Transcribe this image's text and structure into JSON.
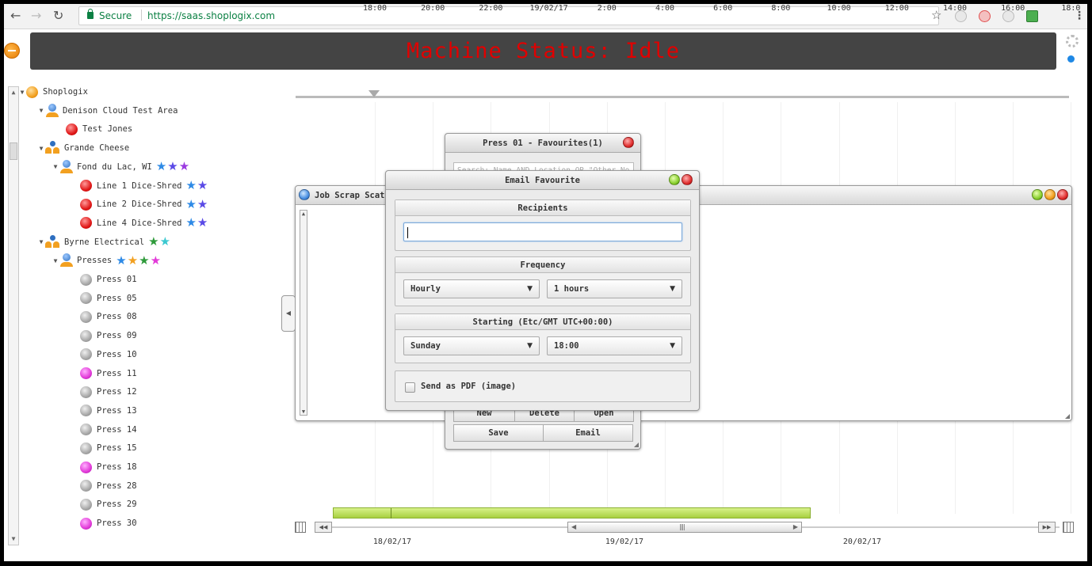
{
  "browser": {
    "secure_label": "Secure",
    "url": "https://saas.shoplogix.com"
  },
  "header": {
    "status_text": "Machine Status: Idle"
  },
  "tree": [
    {
      "label": "Shoplogix",
      "icon": "ball-orange",
      "stars": []
    },
    {
      "label": "Denison Cloud Test Area",
      "icon": "person-icon",
      "stars": []
    },
    {
      "label": "Test Jones",
      "icon": "ball-red",
      "stars": []
    },
    {
      "label": "Grande Cheese",
      "icon": "people-icon",
      "stars": []
    },
    {
      "label": "Fond du Lac, WI",
      "icon": "person-icon",
      "stars": [
        "#2e8ae6",
        "#5a4ae6",
        "#9a3ae0"
      ]
    },
    {
      "label": "Line 1 Dice-Shred",
      "icon": "ball-red",
      "stars": [
        "#2e8ae6",
        "#5a4ae6"
      ]
    },
    {
      "label": "Line 2 Dice-Shred",
      "icon": "ball-red",
      "stars": [
        "#2e8ae6",
        "#5a4ae6"
      ]
    },
    {
      "label": "Line 4 Dice-Shred",
      "icon": "ball-red",
      "stars": [
        "#2e8ae6",
        "#5a4ae6"
      ]
    },
    {
      "label": "Byrne Electrical",
      "icon": "people-icon",
      "stars": [
        "#2e9a3a",
        "#3ac8d0"
      ]
    },
    {
      "label": "Presses",
      "icon": "person-icon",
      "stars": [
        "#2e8ae6",
        "#f2a020",
        "#2e9a3a",
        "#e23ad8"
      ]
    },
    {
      "label": "Press 01",
      "icon": "ball-gray",
      "stars": []
    },
    {
      "label": "Press 05",
      "icon": "ball-gray",
      "stars": []
    },
    {
      "label": "Press 08",
      "icon": "ball-gray",
      "stars": []
    },
    {
      "label": "Press 09",
      "icon": "ball-gray",
      "stars": []
    },
    {
      "label": "Press 10",
      "icon": "ball-gray",
      "stars": []
    },
    {
      "label": "Press 11",
      "icon": "ball-magenta",
      "stars": []
    },
    {
      "label": "Press 12",
      "icon": "ball-gray",
      "stars": []
    },
    {
      "label": "Press 13",
      "icon": "ball-gray",
      "stars": []
    },
    {
      "label": "Press 14",
      "icon": "ball-gray",
      "stars": []
    },
    {
      "label": "Press 15",
      "icon": "ball-gray",
      "stars": []
    },
    {
      "label": "Press 18",
      "icon": "ball-magenta",
      "stars": []
    },
    {
      "label": "Press 28",
      "icon": "ball-gray",
      "stars": []
    },
    {
      "label": "Press 29",
      "icon": "ball-gray",
      "stars": []
    },
    {
      "label": "Press 30",
      "icon": "ball-magenta",
      "stars": []
    }
  ],
  "timeline": {
    "labels": [
      "18:00",
      "20:00",
      "22:00",
      "19/02/17",
      "2:00",
      "4:00",
      "6:00",
      "8:00",
      "10:00",
      "12:00",
      "14:00",
      "16:00",
      "18:0"
    ],
    "dates": [
      "18/02/17",
      "19/02/17",
      "20/02/17"
    ]
  },
  "favourites_window": {
    "title": "Press 01 - Favourites(1)",
    "search_placeholder": "Search: Name AND Location OR \"Other No",
    "buttons": [
      "New",
      "Delete",
      "Open",
      "Save",
      "Email"
    ]
  },
  "scrap_window": {
    "title": "Job Scrap Scatt"
  },
  "email_dialog": {
    "title": "Email Favourite",
    "recipients_header": "Recipients",
    "recipients_value": "",
    "frequency_header": "Frequency",
    "frequency_value": "Hourly",
    "interval_value": "1 hours",
    "starting_header": "Starting (Etc/GMT UTC+00:00)",
    "day_value": "Sunday",
    "time_value": "18:00",
    "pdf_label": "Send as PDF (image)",
    "pdf_checked": false
  },
  "colors": {
    "status_text": "#e00000",
    "status_bar": "#444444",
    "range_bar": "#a8d040"
  }
}
